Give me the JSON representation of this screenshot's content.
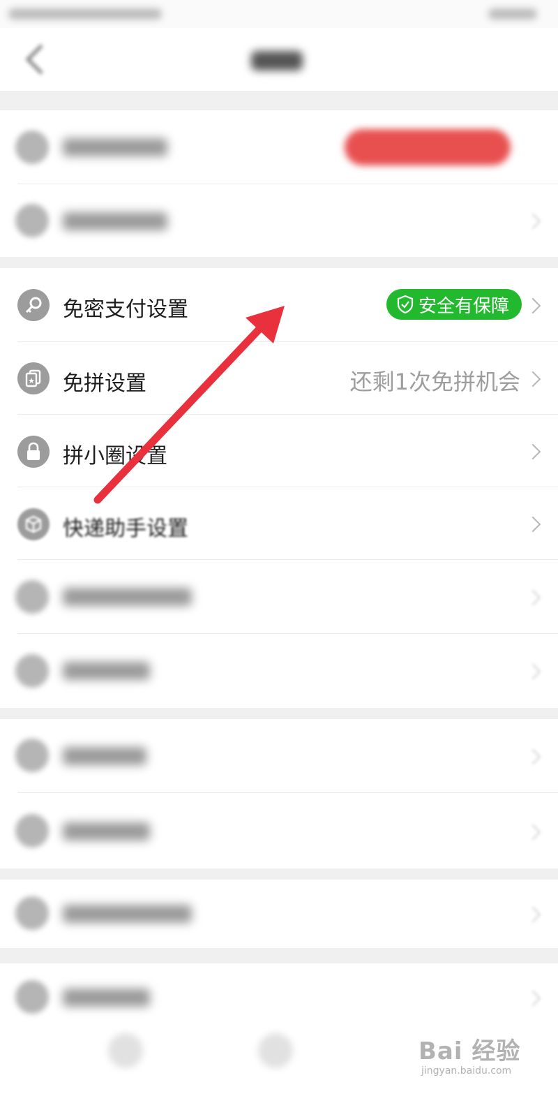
{
  "colors": {
    "badge_green": "#22b92f",
    "arrow_red": "#e8313c",
    "accent_red_pill": "#e85050",
    "icon_gray": "#9c9c9c",
    "chevron_gray": "#b7b7b7"
  },
  "settings": {
    "rows": [
      {
        "label": "免密支付设置",
        "icon": "key-icon",
        "badge": "安全有保障",
        "badge_icon": "shield-check-icon"
      },
      {
        "label": "免拼设置",
        "icon": "star-card-icon",
        "right_text": "还剩1次免拼机会"
      },
      {
        "label": "拼小圈设置",
        "icon": "lock-icon"
      },
      {
        "label": "快递助手设置",
        "icon": "package-icon"
      }
    ]
  },
  "watermark": {
    "main": "Bai 经验",
    "sub": "jingyan.baidu.com"
  }
}
